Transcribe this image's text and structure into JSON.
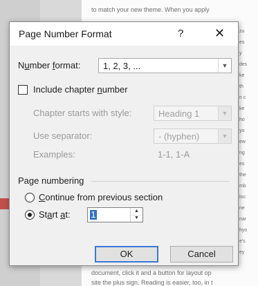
{
  "background": {
    "doc_lines": [
      "to match your new theme. When you apply",
      "document, click it and a button for layout op",
      "site the plus sign. Reading is easier, too, in t"
    ],
    "right_lines": [
      "zu",
      "es",
      "y",
      "des",
      "ke",
      "th",
      "n c",
      "ke",
      "ho",
      "yo",
      "ew",
      "ng",
      "es",
      "the",
      "mb",
      "loc",
      "ne",
      "nar",
      "hyo",
      "e's",
      "ey"
    ]
  },
  "dialog": {
    "title": "Page Number Format",
    "help_glyph": "?",
    "close_glyph": "✕",
    "number_format": {
      "label_prefix": "N",
      "label_underlined": "u",
      "label_suffix": "mber ",
      "label_u2": "f",
      "label_end": "ormat:",
      "value": "1, 2, 3, ..."
    },
    "include_chapter": {
      "label_prefix": "Include chapter ",
      "label_underlined": "n",
      "label_suffix": "umber",
      "checked": false
    },
    "chapter_style": {
      "label": "Chapter starts with style:",
      "value": "Heading 1"
    },
    "separator": {
      "label": "Use separator:",
      "value": "-   (hyphen)"
    },
    "examples": {
      "label": "Examples:",
      "value": "1-1, 1-A"
    },
    "page_numbering": {
      "heading": "Page numbering",
      "continue_label_u": "C",
      "continue_label_rest": "ontinue from previous section",
      "continue_selected": false,
      "start_label_prefix": "St",
      "start_label_u": "a",
      "start_label_suffix": "rt ",
      "start_label_u2": "a",
      "start_label_end": "t:",
      "start_selected": true,
      "start_value": "1"
    },
    "ok_label": "OK",
    "cancel_label": "Cancel"
  },
  "colors": {
    "pointer_arrow": "#c0504d",
    "ok_border": "#3b78d6",
    "selection": "#3072c4"
  }
}
